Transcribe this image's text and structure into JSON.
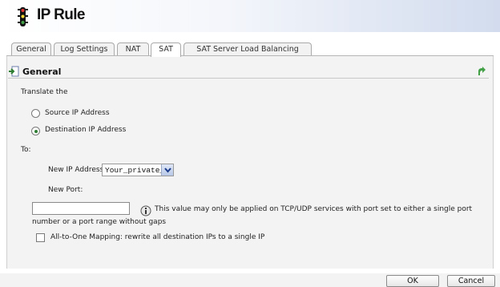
{
  "window": {
    "title": "IP Rule"
  },
  "tabs": [
    {
      "label": "General"
    },
    {
      "label": "Log Settings"
    },
    {
      "label": "NAT"
    },
    {
      "label": "SAT"
    },
    {
      "label": "SAT Server Load Balancing"
    }
  ],
  "active_tab": "SAT",
  "section": {
    "title": "General"
  },
  "form": {
    "translate_label": "Translate the",
    "source_option": "Source IP Address",
    "destination_option": "Destination IP Address",
    "selected_option": "Destination IP Address",
    "to_label": "To:",
    "new_ip_label": "New IP Address:",
    "new_ip_value": "Your_private_IP",
    "new_port_label": "New Port:",
    "new_port_value": "",
    "port_note_line1": "This value may only be applied on TCP/UDP services with port set to either a single port",
    "port_note_line2": "number or a port range without gaps",
    "all_to_one_label": "All-to-One Mapping: rewrite all destination IPs to a single IP",
    "all_to_one_checked": false
  },
  "buttons": {
    "ok": "OK",
    "cancel": "Cancel"
  },
  "colors": {
    "radio_selected": "#2e7d32",
    "title_gradient_end": "#d2dcee"
  },
  "icons": {
    "title_icon": "traffic-light-icon",
    "section_icon": "arrow-in-icon",
    "help_icon": "green-arrow-icon",
    "note_icon": "info-icon",
    "dropdown_icon": "chevron-down-icon"
  }
}
